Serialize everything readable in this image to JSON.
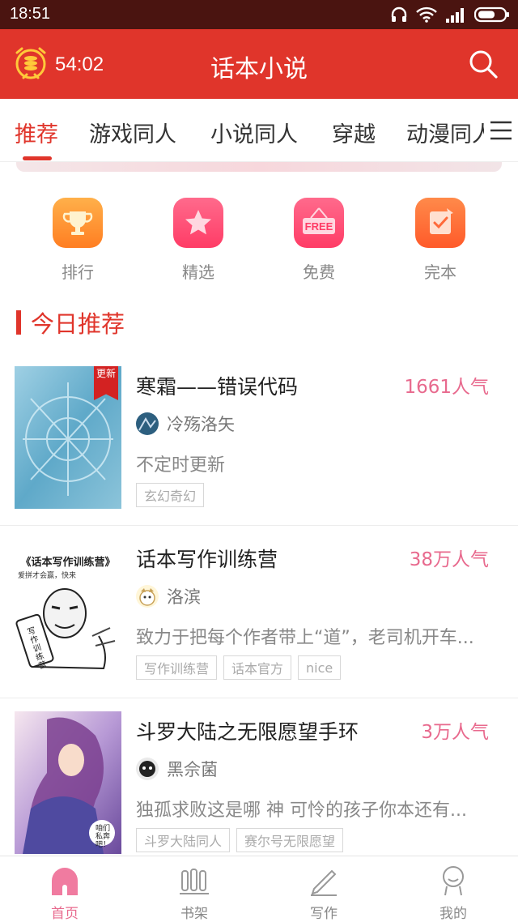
{
  "status_bar": {
    "time": "18:51"
  },
  "header": {
    "timer": "54:02",
    "title": "话本小说"
  },
  "tabs": [
    {
      "label": "推荐",
      "active": true
    },
    {
      "label": "游戏同人",
      "active": false
    },
    {
      "label": "小说同人",
      "active": false
    },
    {
      "label": "穿越",
      "active": false
    },
    {
      "label": "动漫同人",
      "active": false
    }
  ],
  "quick_nav": [
    {
      "label": "排行",
      "icon": "trophy-icon",
      "color": "#ff8a2a"
    },
    {
      "label": "精选",
      "icon": "star-icon",
      "color": "#ff4f78"
    },
    {
      "label": "免费",
      "icon": "free-tag-icon",
      "icon_text": "FREE",
      "color": "#ff4f78"
    },
    {
      "label": "完本",
      "icon": "completed-book-icon",
      "color": "#ff6a3a"
    }
  ],
  "section": {
    "title": "今日推荐"
  },
  "books": [
    {
      "title": "寒霜——错误代码",
      "popularity": "1661人气",
      "author": "冷殇洛矢",
      "description": "不定时更新",
      "tags": [
        "玄幻奇幻"
      ],
      "badge": "更新"
    },
    {
      "title": "话本写作训练营",
      "popularity": "38万人气",
      "author": "洛滨",
      "description": "致力于把每个作者带上“道”，老司机开车...",
      "tags": [
        "写作训练营",
        "话本官方",
        "nice"
      ],
      "cover_text": {
        "title": "《话本写作训练营》",
        "subtitle": "爱拼才会赢，快来",
        "scroll": "写作训练营"
      }
    },
    {
      "title": "斗罗大陆之无限愿望手环",
      "popularity": "3万人气",
      "author": "黑佘菌",
      "description": "独孤求败这是哪 神 可怜的孩子你本还有...",
      "tags": [
        "斗罗大陆同人",
        "赛尔号无限愿望"
      ],
      "cover_text": {
        "speech": "咱们私奔吧！"
      }
    }
  ],
  "bottom_nav": [
    {
      "label": "首页",
      "active": true
    },
    {
      "label": "书架",
      "active": false
    },
    {
      "label": "写作",
      "active": false
    },
    {
      "label": "我的",
      "active": false
    }
  ]
}
